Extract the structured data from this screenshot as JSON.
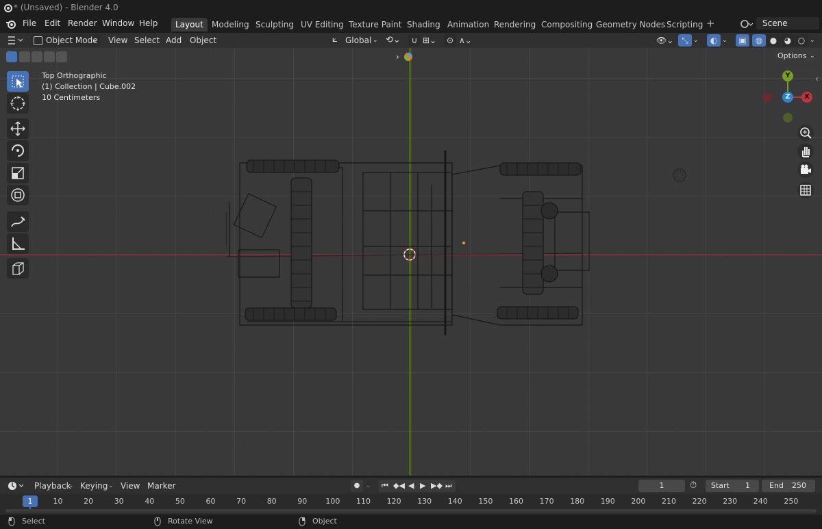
{
  "window": {
    "title": "* (Unsaved) - Blender 4.0"
  },
  "menu": [
    "File",
    "Edit",
    "Render",
    "Window",
    "Help"
  ],
  "workspaces": [
    "Layout",
    "Modeling",
    "Sculpting",
    "UV Editing",
    "Texture Paint",
    "Shading",
    "Animation",
    "Rendering",
    "Compositing",
    "Geometry Nodes",
    "Scripting"
  ],
  "active_workspace": "Layout",
  "scene": {
    "label": "Scene"
  },
  "viewport_header": {
    "mode": "Object Mode",
    "menus": [
      "View",
      "Select",
      "Add",
      "Object"
    ],
    "transform_orientation": "Global",
    "options_label": "Options"
  },
  "viewport_overlay": {
    "view_name": "Top Orthographic",
    "collection": "(1) Collection | Cube.002",
    "scale": "10 Centimeters"
  },
  "gizmo": {
    "y": "Y",
    "x": "X",
    "z": "Z"
  },
  "timeline": {
    "menus": [
      "Playback",
      "Keying",
      "View",
      "Marker"
    ],
    "current_frame": "1",
    "start_label": "Start",
    "start_value": "1",
    "end_label": "End",
    "end_value": "250",
    "ticks": [
      "10",
      "20",
      "30",
      "40",
      "50",
      "60",
      "70",
      "80",
      "90",
      "100",
      "110",
      "120",
      "130",
      "140",
      "150",
      "160",
      "170",
      "180",
      "190",
      "200",
      "210",
      "220",
      "230",
      "240",
      "250"
    ],
    "playhead_label": "1"
  },
  "statusbar": {
    "select": "Select",
    "rotate": "Rotate View",
    "object": "Object"
  },
  "colors": {
    "accent": "#4772b3",
    "x_axis": "#c1323a",
    "y_axis": "#78a020",
    "z_axis": "#2f83cc"
  }
}
